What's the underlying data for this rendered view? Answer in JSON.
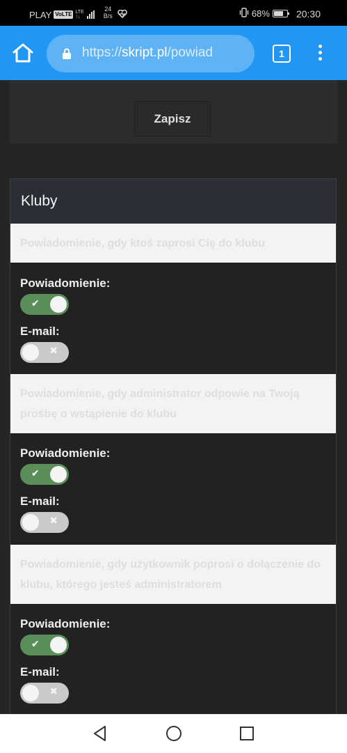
{
  "status_bar": {
    "carrier": "PLAY",
    "volte": "VoLTE",
    "lte_top": "LTE",
    "lte_bottom": "↑↓",
    "speed_value": "24",
    "speed_unit": "B/s",
    "battery": "68%",
    "time": "20:30"
  },
  "browser": {
    "url_scheme": "https://",
    "url_domain": "skript.pl",
    "url_path": "/powiad",
    "tab_count": "1"
  },
  "form": {
    "save_label": "Zapisz"
  },
  "section": {
    "title": "Kluby",
    "items": [
      {
        "question": "Powiadomienie, gdy ktoś zaprosi Cię do klubu",
        "notification_label": "Powiadomienie:",
        "notification_on": true,
        "email_label": "E-mail:",
        "email_on": false
      },
      {
        "question": "Powiadomienie, gdy administrator odpowie na Twoją prośbę o wstąpienie do klubu",
        "notification_label": "Powiadomienie:",
        "notification_on": true,
        "email_label": "E-mail:",
        "email_on": false
      },
      {
        "question": "Powiadomienie, gdy użytkownik poprosi o dołączenie do klubu, którego jesteś administratorem",
        "notification_label": "Powiadomienie:",
        "notification_on": true,
        "email_label": "E-mail:",
        "email_on": false
      }
    ]
  },
  "icons": {
    "check": "✔",
    "cross": "✖"
  },
  "colors": {
    "browser_bar": "#2196f3",
    "toggle_on": "#5a8f5a",
    "toggle_off": "#c9c9c9"
  }
}
